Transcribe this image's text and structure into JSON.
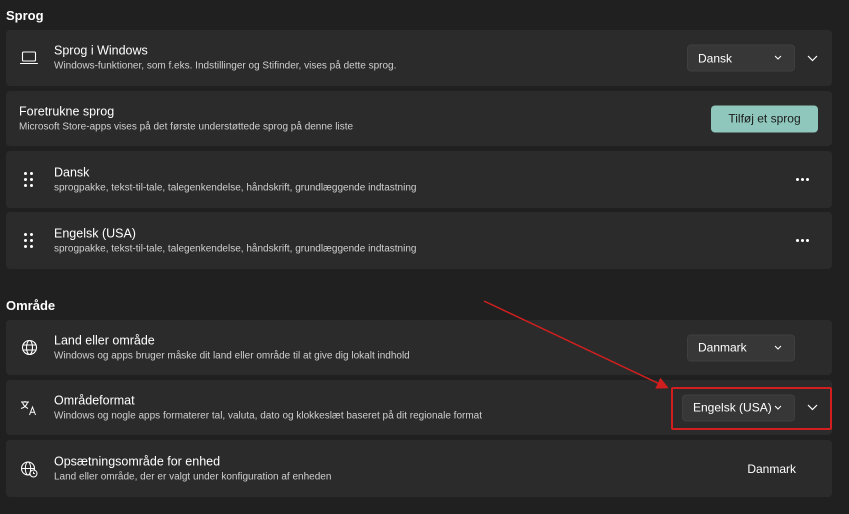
{
  "sprog_section": {
    "title": "Sprog",
    "windows_language": {
      "title": "Sprog i Windows",
      "description": "Windows-funktioner, som f.eks. Indstillinger og Stifinder, vises på dette sprog.",
      "dropdown_value": "Dansk"
    },
    "preferred_languages": {
      "title": "Foretrukne sprog",
      "description": "Microsoft Store-apps vises på det første understøttede sprog på denne liste",
      "add_button_label": "Tilføj et sprog"
    },
    "languages": [
      {
        "name": "Dansk",
        "features": "sprogpakke, tekst-til-tale, talegenkendelse, håndskrift, grundlæggende indtastning"
      },
      {
        "name": "Engelsk (USA)",
        "features": "sprogpakke, tekst-til-tale, talegenkendelse, håndskrift, grundlæggende indtastning"
      }
    ]
  },
  "omraade_section": {
    "title": "Område",
    "country": {
      "title": "Land eller område",
      "description": "Windows og apps bruger måske dit land eller område til at give dig lokalt indhold",
      "dropdown_value": "Danmark"
    },
    "regional_format": {
      "title": "Områdeformat",
      "description": "Windows og nogle apps formaterer tal, valuta, dato og klokkeslæt baseret på dit regionale format",
      "dropdown_value": "Engelsk (USA)"
    },
    "setup_region": {
      "title": "Opsætningsområde for enhed",
      "description": "Land eller område, der er valgt under konfiguration af enheden",
      "value": "Danmark"
    }
  },
  "colors": {
    "background": "#202020",
    "card": "#2b2b2b",
    "accent_button": "#8fc7bd",
    "annotation_red": "#d11f1f"
  },
  "icons": {
    "windows_language": "laptop-icon",
    "country": "globe-icon",
    "regional_format": "language-format-icon",
    "setup_region": "globe-clock-icon",
    "reorder": "drag-handle-icon",
    "more": "more-options-icon",
    "expand": "chevron-down-icon"
  }
}
